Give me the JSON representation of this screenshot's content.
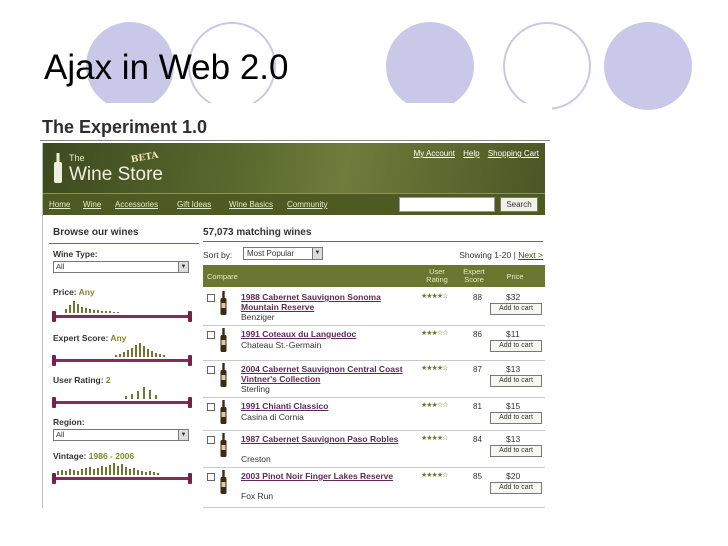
{
  "slide": {
    "title": "Ajax in Web 2.0"
  },
  "screenshot": {
    "heading": "The Experiment 1.0",
    "logo": {
      "the": "The",
      "name": "Wine Store",
      "beta": "BETA"
    },
    "top_links": [
      "My Account",
      "Help",
      "Shopping Cart"
    ],
    "nav": [
      "Home",
      "Wine",
      "Accessories",
      "Gift Ideas",
      "Wine Basics",
      "Community"
    ],
    "search": {
      "button": "Search",
      "value": ""
    },
    "filters": {
      "heading": "Browse our wines",
      "wine_type": {
        "label": "Wine Type:",
        "value": "All"
      },
      "price": {
        "label": "Price:",
        "value": "Any"
      },
      "expert_score": {
        "label": "Expert Score:",
        "value": "Any"
      },
      "user_rating": {
        "label": "User Rating:",
        "value": "2"
      },
      "region": {
        "label": "Region:",
        "value": "All"
      },
      "vintage": {
        "label": "Vintage:",
        "value": "1986 - 2006"
      }
    },
    "results": {
      "count_text": "57,073 matching wines",
      "sort_label": "Sort by:",
      "sort_value": "Most Popular",
      "showing": "Showing 1-20 |",
      "next": "Next >",
      "columns": {
        "compare": "Compare",
        "user_rating": "User Rating",
        "expert_score": "Expert Score",
        "price": "Price"
      },
      "cart_label": "Add to cart",
      "rows": [
        {
          "name": "1988 Cabernet Sauvignon Sonoma Mountain Reserve",
          "producer": "Benziger",
          "stars": "★★★★☆",
          "score": "88",
          "price": "$32"
        },
        {
          "name": "1991 Coteaux du Languedoc",
          "producer": "Chateau St.-Germain",
          "stars": "★★★☆☆",
          "score": "86",
          "price": "$11"
        },
        {
          "name": "2004 Cabernet Sauvignon Central Coast Vintner's Collection",
          "producer": "Sterling",
          "stars": "★★★★☆",
          "score": "87",
          "price": "$13"
        },
        {
          "name": "1991 Chianti Classico",
          "producer": "Casina di Cornia",
          "stars": "★★★☆☆",
          "score": "81",
          "price": "$15"
        },
        {
          "name": "1987 Cabernet Sauvignon Paso Robles",
          "producer": "Creston",
          "stars": "★★★★☆",
          "score": "84",
          "price": "$13"
        },
        {
          "name": "2003 Pinot Noir Finger Lakes Reserve",
          "producer": "Fox Run",
          "stars": "★★★★☆",
          "score": "85",
          "price": "$20"
        }
      ]
    }
  }
}
